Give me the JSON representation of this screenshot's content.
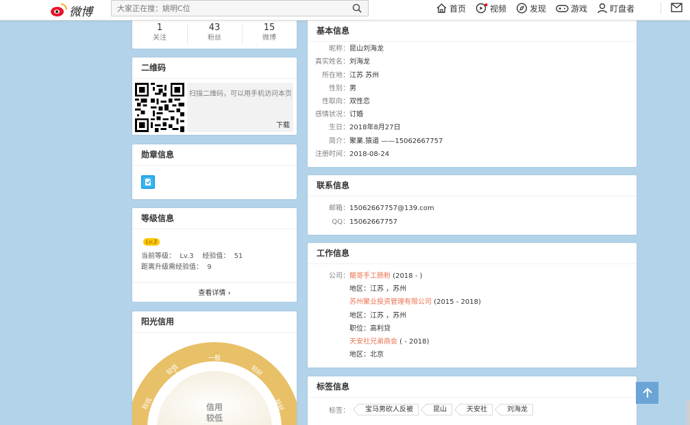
{
  "header": {
    "logo_text": "微博",
    "search_placeholder": "大家正在搜：姚明C位",
    "nav": [
      {
        "label": "首页",
        "icon": "home-icon"
      },
      {
        "label": "视频",
        "icon": "video-icon"
      },
      {
        "label": "发现",
        "icon": "compass-icon"
      },
      {
        "label": "游戏",
        "icon": "gamepad-icon"
      },
      {
        "label": "盯盘者",
        "icon": "user-icon"
      }
    ]
  },
  "stats": [
    {
      "count": "1",
      "label": "关注"
    },
    {
      "count": "43",
      "label": "粉丝"
    },
    {
      "count": "15",
      "label": "微博"
    }
  ],
  "qrcode": {
    "title": "二维码",
    "tip": "扫描二维码，可以用手机访问本页",
    "download": "下载"
  },
  "medal": {
    "title": "勋章信息"
  },
  "level": {
    "title": "等级信息",
    "badge": "Lv.3",
    "line1": "当前等级：  Lv.3    经验值：  51",
    "line2": "距离升级需经验值：  9",
    "more": "查看详情"
  },
  "credit": {
    "title": "阳光信用",
    "gauge_labels": [
      "较低",
      "较低",
      "一般",
      "较好",
      "极好"
    ],
    "center_line1": "信用",
    "center_line2": "较低"
  },
  "basic": {
    "title": "基本信息",
    "rows": [
      {
        "k": "昵称：",
        "v": "昆山刘海龙"
      },
      {
        "k": "真实姓名：",
        "v": "刘海龙"
      },
      {
        "k": "所在地：",
        "v": "江苏 苏州"
      },
      {
        "k": "性别：",
        "v": "男"
      },
      {
        "k": "性取向：",
        "v": "双性恋"
      },
      {
        "k": "感情状况：",
        "v": "订婚"
      },
      {
        "k": "生日：",
        "v": "2018年8月27日"
      },
      {
        "k": "简介：",
        "v": "聚業.猿道 ——15062667757"
      },
      {
        "k": "注册时间：",
        "v": "2018-08-24"
      }
    ]
  },
  "contact": {
    "title": "联系信息",
    "rows": [
      {
        "k": "邮箱：",
        "v": "15062667757@139.com"
      },
      {
        "k": "QQ：",
        "v": "15062667757"
      }
    ]
  },
  "work": {
    "title": "工作信息",
    "company_label": "公司：",
    "c1_name": "龍哥手工肠粉",
    "c1_period": " (2018 - )",
    "c1_region": "地区：江苏 ，苏州",
    "c2_name": "苏州聚业投资管理有限公司",
    "c2_period": " (2015 - 2018)",
    "c2_region": "地区：江苏 ，苏州",
    "c2_position": "职位：高利贷",
    "c3_name": "天安社兄弟商会",
    "c3_period": " ( - 2018)",
    "c3_region": "地区：北京"
  },
  "tags": {
    "title": "标签信息",
    "label": "标签：",
    "items": [
      "宝马男砍人反被",
      "昆山",
      "天安社",
      "刘海龙"
    ]
  },
  "colors": {
    "accent_link": "#eb7350",
    "badge": "#ffc700",
    "gauge": "#e8c067",
    "totop": "#6ba4d6"
  }
}
